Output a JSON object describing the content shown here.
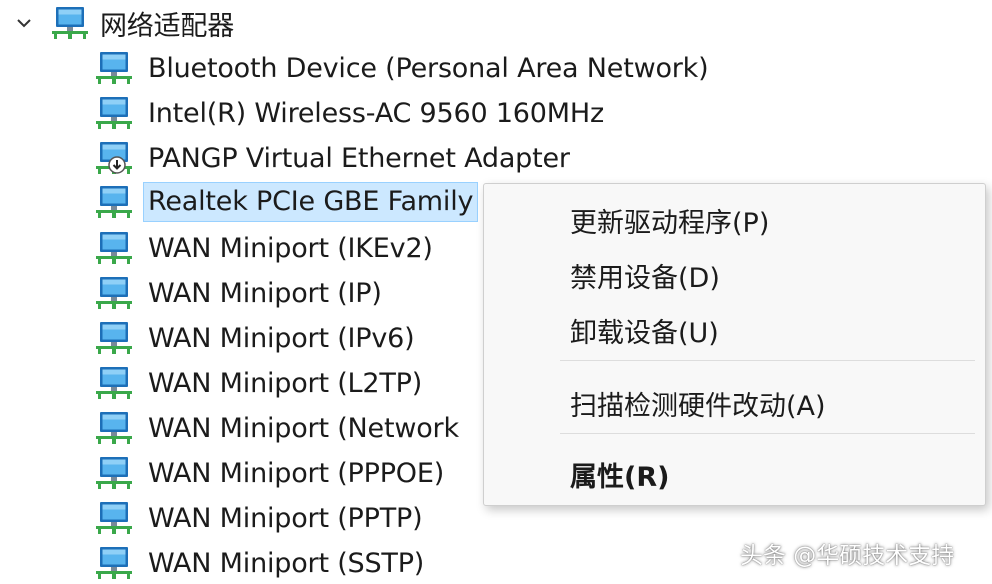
{
  "tree": {
    "category": {
      "label": "网络适配器",
      "icon": "network-adapter-icon",
      "expanded": true
    },
    "devices": [
      {
        "label": "Bluetooth Device (Personal Area Network)",
        "icon": "network-adapter-icon"
      },
      {
        "label": "Intel(R) Wireless-AC 9560 160MHz",
        "icon": "network-adapter-icon"
      },
      {
        "label": "PANGP Virtual Ethernet Adapter",
        "icon": "network-adapter-disabled-icon"
      },
      {
        "label": "Realtek PCIe GBE Family",
        "icon": "network-adapter-icon",
        "selected": true
      },
      {
        "label": "WAN Miniport (IKEv2)",
        "icon": "network-adapter-icon"
      },
      {
        "label": "WAN Miniport (IP)",
        "icon": "network-adapter-icon"
      },
      {
        "label": "WAN Miniport (IPv6)",
        "icon": "network-adapter-icon"
      },
      {
        "label": "WAN Miniport (L2TP)",
        "icon": "network-adapter-icon"
      },
      {
        "label": "WAN Miniport (Network",
        "icon": "network-adapter-icon"
      },
      {
        "label": "WAN Miniport (PPPOE)",
        "icon": "network-adapter-icon"
      },
      {
        "label": "WAN Miniport (PPTP)",
        "icon": "network-adapter-icon"
      },
      {
        "label": "WAN Miniport (SSTP)",
        "icon": "network-adapter-icon"
      }
    ]
  },
  "context_menu": {
    "items": [
      {
        "label": "更新驱动程序(P)"
      },
      {
        "label": "禁用设备(D)"
      },
      {
        "label": "卸载设备(U)"
      },
      {
        "label": "扫描检测硬件改动(A)"
      },
      {
        "label": "属性(R)",
        "bold": true
      }
    ]
  },
  "watermark": {
    "text": "头条 @华硕技术支持"
  },
  "colors": {
    "selection": "#cce8ff",
    "menu_bg": "#f8f8f8",
    "monitor_blue": "#2f8ed8",
    "network_green": "#3aa84a"
  }
}
